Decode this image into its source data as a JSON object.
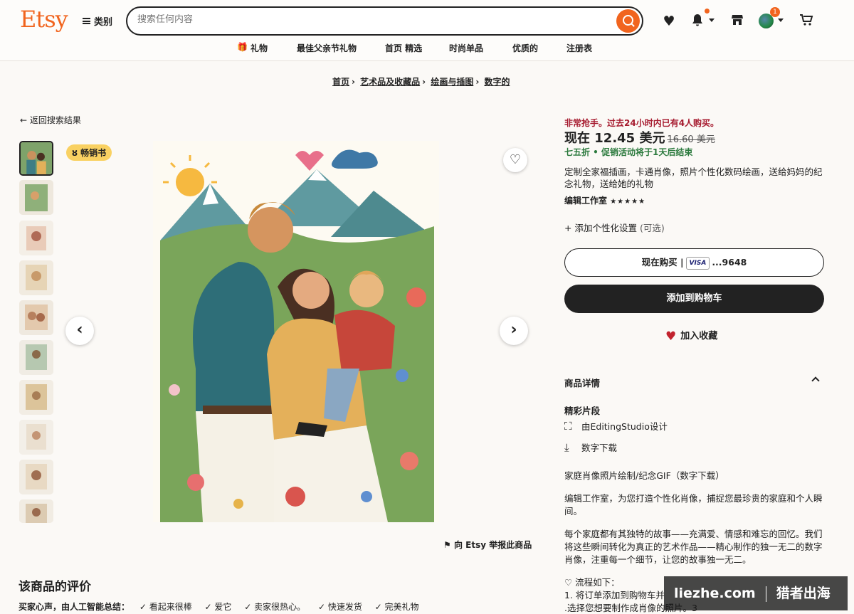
{
  "header": {
    "logo": "Etsy",
    "categories_label": "类别",
    "search_placeholder": "搜索任何内容",
    "cart_count": "1"
  },
  "nav": [
    "礼物",
    "最佳父亲节礼物",
    "首页 精选",
    "时尚单品",
    "优质的",
    "注册表"
  ],
  "breadcrumb": [
    "首页",
    "艺术品及收藏品",
    "绘画与插图",
    "数字的"
  ],
  "back_link": "返回搜索结果",
  "bestseller": "畅销书",
  "report_link": "向 Etsy 举报此商品",
  "product": {
    "urgency": "非常抢手。过去24小时内已有4人购买。",
    "price_now": "现在 12.45 美元",
    "price_old": "16.60 美元",
    "sale_text": "七五折 • 促销活动将于1天后结束",
    "title": "定制全家福插画，卡通肖像，照片个性化数码绘画，送给妈妈的纪念礼物，送给她的礼物",
    "shop": "编辑工作室",
    "stars": "★★★★★",
    "personalize": "添加个性化设置",
    "optional": "(可选)",
    "buy_now": "现在购买 |",
    "visa": "VISA",
    "card_last": "...9648",
    "add_to_cart": "添加到购物车",
    "add_favorite": "加入收藏"
  },
  "details": {
    "heading": "商品详情",
    "highlights": "精彩片段",
    "designed_by": "由EditingStudio设计",
    "digital_download": "数字下载",
    "desc": [
      "家庭肖像照片绘制/纪念GIF（数字下载）",
      "编辑工作室，为您打造个性化肖像，捕捉您最珍贵的家庭和个人瞬间。",
      "每个家庭都有其独特的故事——充满爱、情感和难忘的回忆。我们将这些瞬间转化为真正的艺术作品——精心制作的独一无二的数字肖像，注重每一个细节，让您的故事独一无二。",
      "♡ 流程如下：",
      "1. 将订单添加到购物车并",
      ".选择您想要制作成肖像的照片。3"
    ]
  },
  "reviews": {
    "title": "该商品的评价",
    "summary_label": "买家心声，由人工智能总结：",
    "tags": [
      "✓ 看起来很棒",
      "✓ 爱它",
      "✓ 卖家很热心。",
      "✓ 快速发货",
      "✓ 完美礼物"
    ]
  },
  "watermark": {
    "left": "liezhe.com",
    "right": "猎者出海"
  },
  "colors": {
    "brand": "#f1641e",
    "cart_button": "#222222",
    "urgent": "#a61a2e",
    "sale": "#2b7a3d",
    "bestseller": "#f9d162"
  }
}
